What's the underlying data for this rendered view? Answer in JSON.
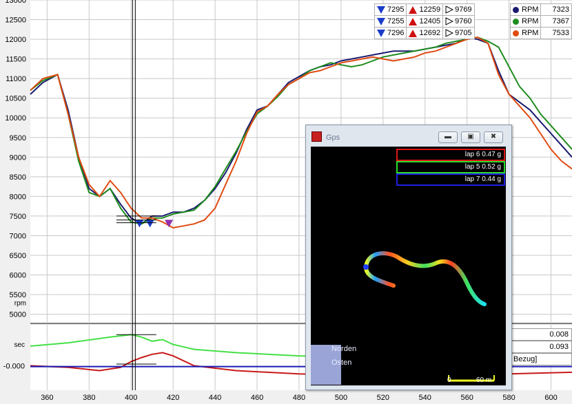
{
  "colors": {
    "blue": "#1a1a6e",
    "green": "#1e8c1e",
    "red": "#e04a10",
    "ref_green": "#44e044",
    "ref_red": "#c81818",
    "ref_blue": "#1a1ab4",
    "grid": "#c8c8c8"
  },
  "stats": {
    "rows": [
      {
        "min": "7295",
        "max": "12259",
        "avg": "9769"
      },
      {
        "min": "7255",
        "max": "12405",
        "avg": "9760"
      },
      {
        "min": "7296",
        "max": "12692",
        "avg": "9705"
      }
    ]
  },
  "rpm_legend": [
    {
      "label": "RPM",
      "value": "7323",
      "color": "#1a1a6e"
    },
    {
      "label": "RPM",
      "value": "7367",
      "color": "#1e8c1e"
    },
    {
      "label": "RPM",
      "value": "7533",
      "color": "#e04a10"
    }
  ],
  "lower_values": {
    "v1": "0.008",
    "v2": "0.093",
    "v3": "Bezug]"
  },
  "gps": {
    "title": "Gps",
    "laps": [
      {
        "label": "lap 6 0.47 g",
        "color": "#e01818"
      },
      {
        "label": "lap 5 0.52 g",
        "color": "#2ce02c"
      },
      {
        "label": "lap 7 0.44 g",
        "color": "#2020e0"
      }
    ],
    "compass_north": "Norden",
    "compass_east": "Osten",
    "scale_zero": "0",
    "scale_end": "60 m"
  },
  "chart_data": [
    {
      "type": "line",
      "ylabel": "rpm",
      "xlim": [
        352,
        610
      ],
      "ylim": [
        4800,
        13000
      ],
      "yticks": [
        5000,
        5500,
        6000,
        6500,
        7000,
        7500,
        8000,
        8500,
        9000,
        9500,
        10000,
        10500,
        11000,
        11500,
        12000,
        12500,
        13000
      ],
      "xticks": [
        360,
        380,
        400,
        420,
        440,
        460,
        480,
        500,
        520,
        540,
        560,
        580,
        600
      ],
      "cursor_x": 402,
      "series": [
        {
          "color": "#1a1a6e",
          "x": [
            352,
            358,
            365,
            370,
            375,
            380,
            385,
            390,
            395,
            400,
            405,
            410,
            415,
            420,
            425,
            430,
            435,
            440,
            445,
            450,
            455,
            460,
            465,
            470,
            475,
            480,
            485,
            490,
            495,
            500,
            505,
            510,
            515,
            520,
            525,
            530,
            535,
            540,
            545,
            550,
            555,
            560,
            565,
            570,
            575,
            580,
            585,
            590,
            595,
            600,
            605,
            610
          ],
          "y": [
            10600,
            10900,
            11100,
            10200,
            9000,
            8200,
            8000,
            8200,
            7800,
            7450,
            7300,
            7500,
            7500,
            7600,
            7600,
            7700,
            7900,
            8200,
            8600,
            9100,
            9700,
            10200,
            10300,
            10600,
            10900,
            11050,
            11200,
            11300,
            11350,
            11450,
            11500,
            11550,
            11600,
            11650,
            11700,
            11700,
            11700,
            11750,
            11800,
            11850,
            11900,
            12050,
            12000,
            11900,
            11200,
            10600,
            10400,
            10200,
            9900,
            9600,
            9300,
            9000
          ]
        },
        {
          "color": "#1e8c1e",
          "x": [
            352,
            358,
            365,
            370,
            375,
            380,
            385,
            390,
            395,
            400,
            405,
            410,
            415,
            420,
            425,
            430,
            435,
            440,
            445,
            450,
            455,
            460,
            465,
            470,
            475,
            480,
            485,
            490,
            495,
            500,
            505,
            510,
            515,
            520,
            525,
            530,
            535,
            540,
            545,
            550,
            555,
            560,
            565,
            570,
            575,
            580,
            585,
            590,
            595,
            600,
            605,
            610
          ],
          "y": [
            10700,
            10950,
            11100,
            10100,
            8900,
            8100,
            8000,
            8200,
            7700,
            7350,
            7300,
            7450,
            7450,
            7550,
            7600,
            7650,
            7900,
            8250,
            8700,
            9150,
            9650,
            10100,
            10300,
            10550,
            10850,
            11000,
            11200,
            11300,
            11400,
            11350,
            11300,
            11350,
            11450,
            11550,
            11600,
            11650,
            11700,
            11750,
            11800,
            11900,
            11950,
            12000,
            12050,
            11950,
            11800,
            11300,
            10800,
            10500,
            10100,
            9800,
            9500,
            9200
          ]
        },
        {
          "color": "#e04a10",
          "x": [
            352,
            358,
            365,
            370,
            375,
            380,
            385,
            390,
            395,
            400,
            405,
            410,
            415,
            420,
            425,
            430,
            435,
            440,
            445,
            450,
            455,
            460,
            465,
            470,
            475,
            480,
            485,
            490,
            495,
            500,
            505,
            510,
            515,
            520,
            525,
            530,
            535,
            540,
            545,
            550,
            555,
            560,
            565,
            570,
            575,
            580,
            585,
            590,
            595,
            600,
            605,
            610
          ],
          "y": [
            10700,
            11000,
            11100,
            10100,
            9000,
            8300,
            8000,
            8400,
            8100,
            7700,
            7450,
            7450,
            7350,
            7200,
            7250,
            7300,
            7400,
            7700,
            8300,
            8900,
            9600,
            10150,
            10300,
            10600,
            10850,
            11000,
            11150,
            11200,
            11300,
            11400,
            11450,
            11500,
            11550,
            11500,
            11450,
            11500,
            11550,
            11650,
            11700,
            11800,
            11900,
            12000,
            12050,
            11900,
            11100,
            10600,
            10300,
            10000,
            9600,
            9200,
            8900,
            8700
          ]
        }
      ]
    },
    {
      "type": "line",
      "ylabel": "sec",
      "ytick_labels": [
        "-0.000"
      ],
      "ylim": [
        -0.3,
        0.5
      ],
      "series": [
        {
          "color": "#44e044",
          "x": [
            352,
            370,
            390,
            400,
            405,
            410,
            415,
            420,
            430,
            450,
            480,
            520,
            560,
            580,
            610
          ],
          "y": [
            0.24,
            0.28,
            0.35,
            0.38,
            0.35,
            0.3,
            0.32,
            0.26,
            0.2,
            0.16,
            0.12,
            0.1,
            0.09,
            0.08,
            0.08
          ]
        },
        {
          "color": "#c81818",
          "x": [
            352,
            370,
            385,
            395,
            400,
            405,
            410,
            415,
            420,
            430,
            450,
            480,
            520,
            560,
            580,
            610
          ],
          "y": [
            0.0,
            -0.02,
            -0.06,
            -0.02,
            0.05,
            0.1,
            0.14,
            0.16,
            0.12,
            0.0,
            -0.06,
            -0.1,
            -0.12,
            -0.1,
            -0.1,
            -0.08
          ]
        },
        {
          "color": "#1a1ab4",
          "x": [
            352,
            610
          ],
          "y": [
            -0.01,
            -0.01
          ]
        }
      ]
    }
  ]
}
